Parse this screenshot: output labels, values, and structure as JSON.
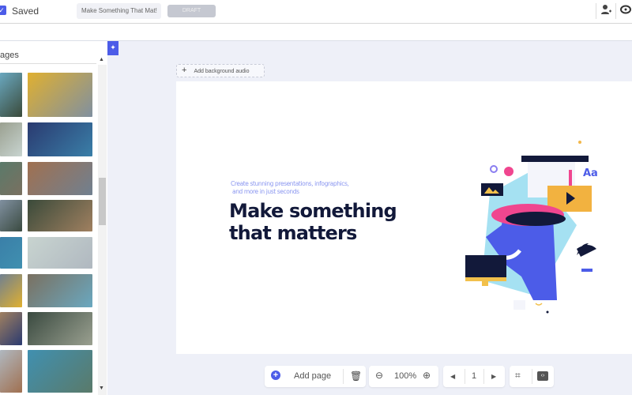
{
  "header": {
    "saved_label": "Saved",
    "title_value": "Make Something That Mat!",
    "draft_label": "DRAFT",
    "icons": [
      "add-user-icon",
      "preview-eye-icon"
    ]
  },
  "sidebar": {
    "heading": "ages"
  },
  "canvas": {
    "add_audio_label": "Add background audio",
    "subtitle_line1": "Create stunning presentations, infographics,",
    "subtitle_line2": "and more in just seconds",
    "headline_line1": "Make something",
    "headline_line2": "that matters"
  },
  "toolbar": {
    "add_page_label": "Add page",
    "zoom_value": "100%",
    "page_number": "1"
  },
  "colors": {
    "accent": "#4c5ce8",
    "headline": "#12193a",
    "subtitle": "#8a96f0"
  }
}
